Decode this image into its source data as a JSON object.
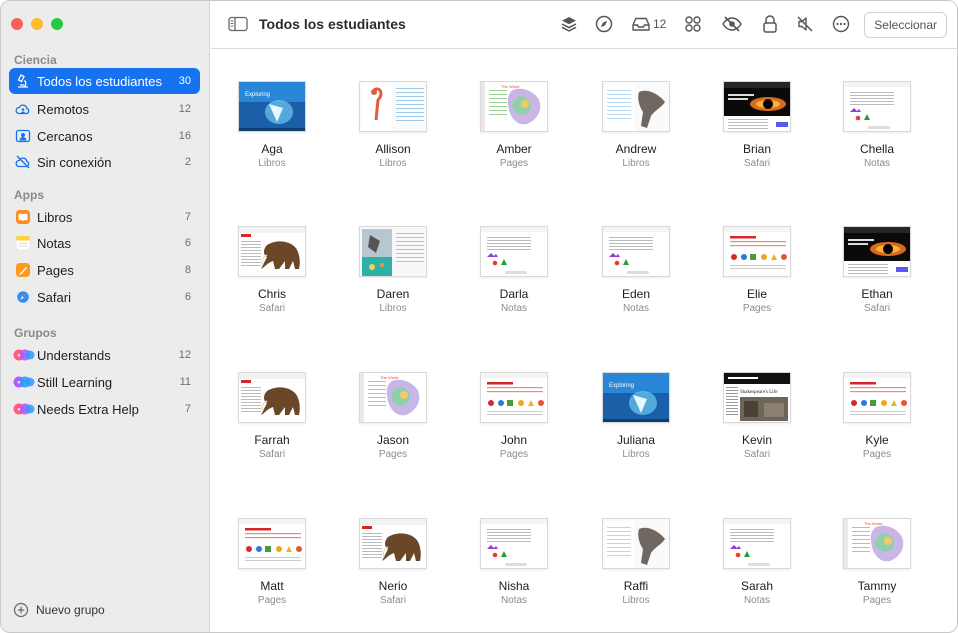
{
  "window": {
    "title": "Todos los estudiantes",
    "select_label": "Seleccionar",
    "inbox_count": "12",
    "new_group_label": "Nuevo grupo"
  },
  "colors": {
    "accent": "#1672ef",
    "close": "#fe5f57",
    "minimize": "#febc2e",
    "zoom": "#28c840"
  },
  "sidebar": {
    "sections": [
      {
        "title": "Ciencia",
        "items": [
          {
            "label": "Todos los estudiantes",
            "count": "30",
            "icon": "microscope-icon"
          },
          {
            "label": "Remotos",
            "count": "12",
            "icon": "cloud-person-icon"
          },
          {
            "label": "Cercanos",
            "count": "16",
            "icon": "person-card-icon"
          },
          {
            "label": "Sin conexión",
            "count": "2",
            "icon": "cloud-off-icon"
          }
        ]
      },
      {
        "title": "Apps",
        "items": [
          {
            "label": "Libros",
            "count": "7",
            "icon": "books-icon"
          },
          {
            "label": "Notas",
            "count": "6",
            "icon": "notes-icon"
          },
          {
            "label": "Pages",
            "count": "8",
            "icon": "pages-icon"
          },
          {
            "label": "Safari",
            "count": "6",
            "icon": "safari-icon"
          }
        ]
      },
      {
        "title": "Grupos",
        "items": [
          {
            "label": "Understands",
            "count": "12",
            "icon": "group-icon"
          },
          {
            "label": "Still Learning",
            "count": "11",
            "icon": "group-icon"
          },
          {
            "label": "Needs Extra Help",
            "count": "7",
            "icon": "group-icon"
          }
        ]
      }
    ]
  },
  "students": [
    {
      "name": "Aga",
      "app": "Libros",
      "thumb": "ocean"
    },
    {
      "name": "Allison",
      "app": "Libros",
      "thumb": "flamingo"
    },
    {
      "name": "Amber",
      "app": "Pages",
      "thumb": "map"
    },
    {
      "name": "Andrew",
      "app": "Libros",
      "thumb": "skull"
    },
    {
      "name": "Brian",
      "app": "Safari",
      "thumb": "blackhole"
    },
    {
      "name": "Chella",
      "app": "Notas",
      "thumb": "notes"
    },
    {
      "name": "Chris",
      "app": "Safari",
      "thumb": "mammoth"
    },
    {
      "name": "Daren",
      "app": "Libros",
      "thumb": "reef"
    },
    {
      "name": "Darla",
      "app": "Notas",
      "thumb": "notes"
    },
    {
      "name": "Eden",
      "app": "Notas",
      "thumb": "notes"
    },
    {
      "name": "Elie",
      "app": "Pages",
      "thumb": "investigation"
    },
    {
      "name": "Ethan",
      "app": "Safari",
      "thumb": "blackhole"
    },
    {
      "name": "Farrah",
      "app": "Safari",
      "thumb": "mammoth"
    },
    {
      "name": "Jason",
      "app": "Pages",
      "thumb": "map"
    },
    {
      "name": "John",
      "app": "Pages",
      "thumb": "investigation"
    },
    {
      "name": "Juliana",
      "app": "Libros",
      "thumb": "ocean"
    },
    {
      "name": "Kevin",
      "app": "Safari",
      "thumb": "history"
    },
    {
      "name": "Kyle",
      "app": "Pages",
      "thumb": "investigation"
    },
    {
      "name": "Matt",
      "app": "Pages",
      "thumb": "investigation"
    },
    {
      "name": "Nerio",
      "app": "Safari",
      "thumb": "mammoth"
    },
    {
      "name": "Nisha",
      "app": "Notas",
      "thumb": "notes"
    },
    {
      "name": "Raffi",
      "app": "Libros",
      "thumb": "skull"
    },
    {
      "name": "Sarah",
      "app": "Notas",
      "thumb": "notes"
    },
    {
      "name": "Tammy",
      "app": "Pages",
      "thumb": "map"
    }
  ],
  "toolbar_icons": [
    "layers-icon",
    "compass-icon",
    "inbox-icon",
    "apps-grid-icon",
    "hide-eye-icon",
    "lock-icon",
    "mute-icon",
    "more-icon"
  ]
}
